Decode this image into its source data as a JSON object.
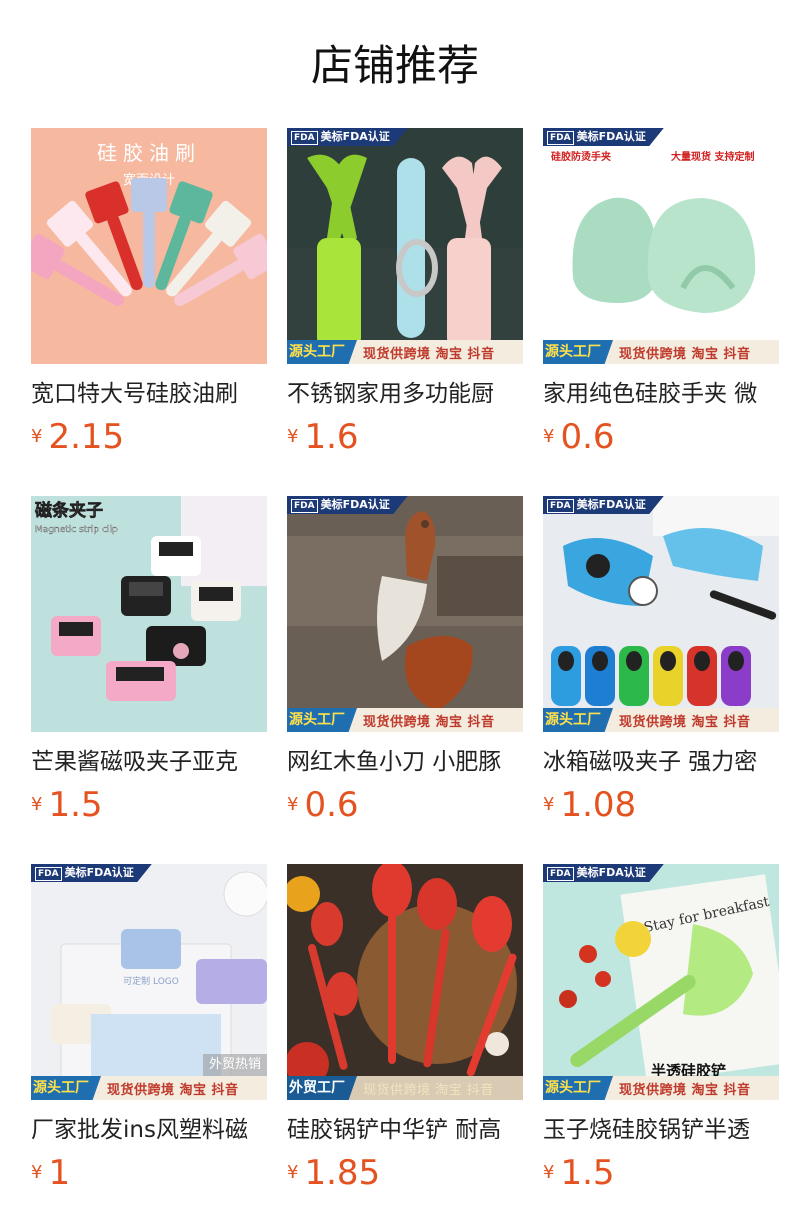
{
  "page_title": "店铺推荐",
  "badge": {
    "fda_logo": "FDA",
    "fda_text": "美标FDA认证"
  },
  "origin_text": "现货供跨境 淘宝 抖音",
  "currency": "¥",
  "colors": {
    "price": "#e4531f",
    "origin_tag": "#1f6fb0",
    "fda_badge": "#1d3a78"
  },
  "products": [
    {
      "name": "宽口特大号硅胶油刷",
      "price": "2.15",
      "img_title": "硅胶油刷",
      "img_sub": "宽面设计"
    },
    {
      "name": "不锈钢家用多功能厨",
      "price": "1.6",
      "origin_tag": "源头工厂"
    },
    {
      "name": "家用纯色硅胶手夹 微",
      "price": "0.6",
      "origin_tag": "源头工厂",
      "img_red1": "硅胶防烫手夹",
      "img_red2": "大量现货 支持定制"
    },
    {
      "name": "芒果酱磁吸夹子亚克",
      "price": "1.5",
      "img_title": "磁条夹子",
      "img_sub": "Magnetic strip clip"
    },
    {
      "name": "网红木鱼小刀 小肥豚",
      "price": "0.6",
      "origin_tag": "源头工厂"
    },
    {
      "name": "冰箱磁吸夹子 强力密",
      "price": "1.08",
      "origin_tag": "源头工厂"
    },
    {
      "name": "厂家批发ins风塑料磁",
      "price": "1",
      "origin_tag": "源头工厂",
      "hot_tag": "外贸热销",
      "img_sub": "可定制 LOGO"
    },
    {
      "name": "硅胶锅铲中华铲 耐高",
      "price": "1.85",
      "origin_tag": "外贸工厂"
    },
    {
      "name": "玉子烧硅胶锅铲半透",
      "price": "1.5",
      "origin_tag": "源头工厂",
      "img_title": "半透硅胶铲",
      "img_sub": "Stay for breakfast"
    }
  ]
}
